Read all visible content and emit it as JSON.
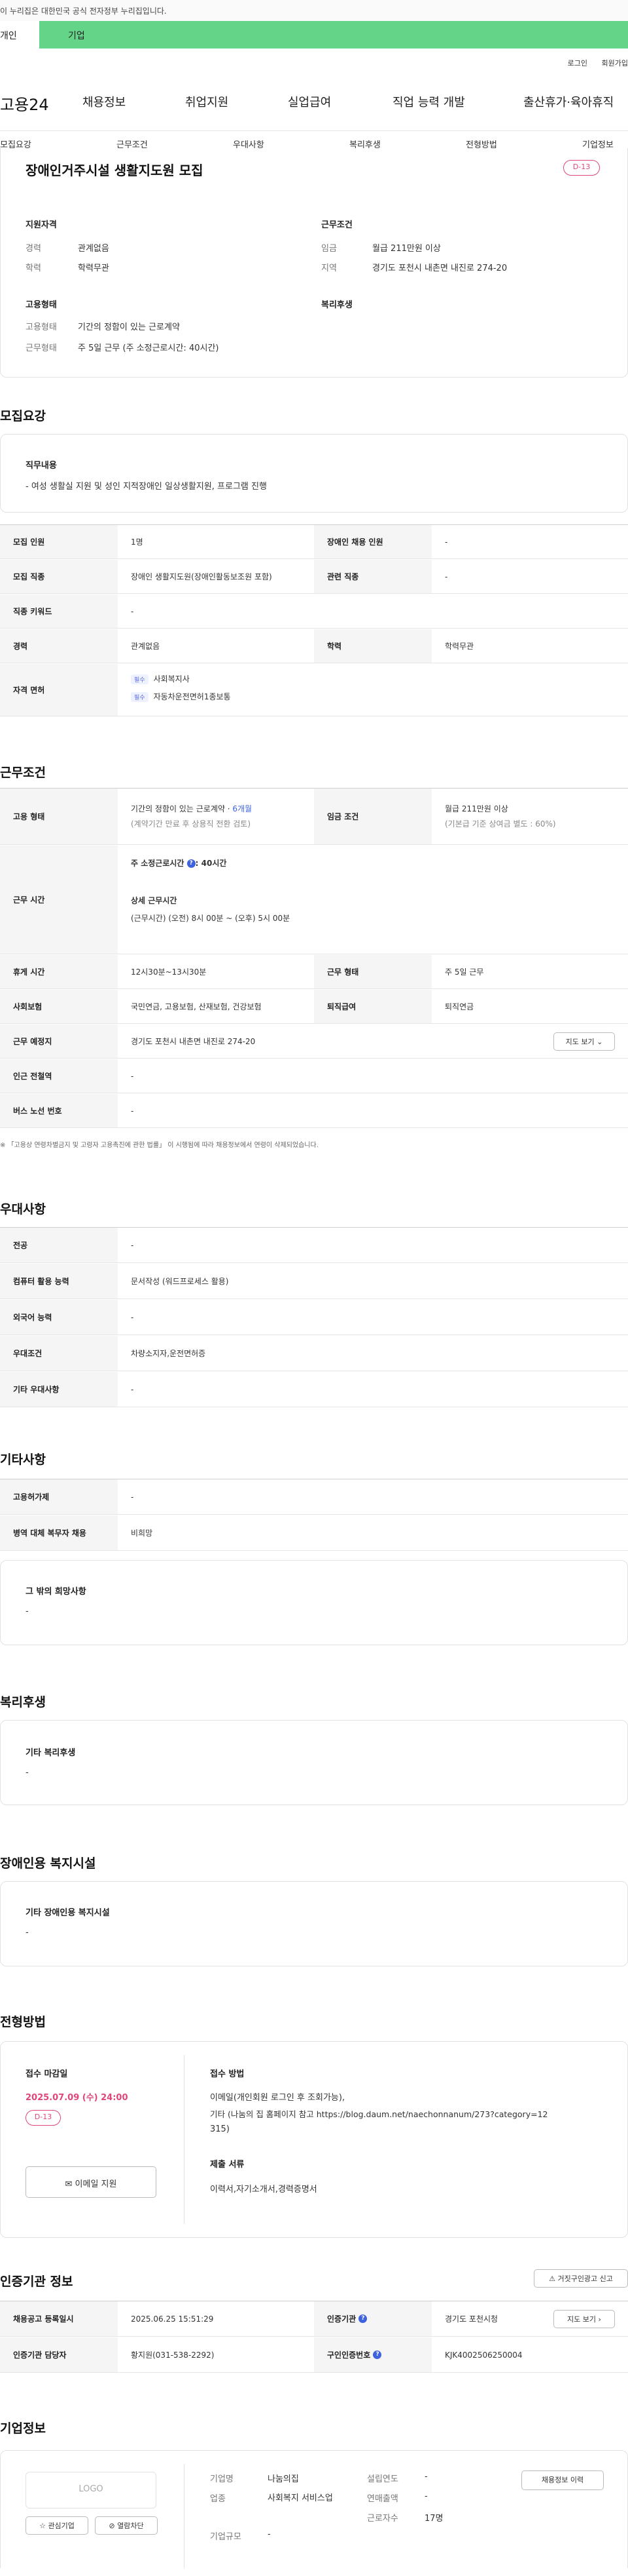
{
  "gov_banner": "이 누리집은 대한민국 공식 전자정부 누리집입니다.",
  "user_tabs": {
    "personal": "개인",
    "company": "기업"
  },
  "top_links": {
    "login": "로그인",
    "join": "회원가입"
  },
  "brand": "고용24",
  "gnb": [
    "채용정보",
    "취업지원",
    "실업급여",
    "직업 능력 개발",
    "출산휴가·육아휴직"
  ],
  "subnav": [
    "모집요강",
    "근무조건",
    "우대사항",
    "복리후생",
    "전형방법",
    "기업정보"
  ],
  "header": {
    "title": "장애인거주시설 생활지도원 모집",
    "dday": "D-13",
    "qual_title": "지원자격",
    "qual": [
      {
        "l": "경력",
        "v": "관계없음"
      },
      {
        "l": "학력",
        "v": "학력무관"
      }
    ],
    "work_title": "근무조건",
    "work": [
      {
        "l": "임금",
        "v": "월급 211만원 이상"
      },
      {
        "l": "지역",
        "v": "경기도 포천시 내촌면 내진로 274-20"
      }
    ],
    "emp_title": "고용형태",
    "emp": [
      {
        "l": "고용형태",
        "v": "기간의 정함이 있는 근로계약"
      },
      {
        "l": "근무형태",
        "v": "주 5일 근무 (주 소정근로시간: 40시간)"
      }
    ],
    "welfare_title": "복리후생"
  },
  "recruit": {
    "section": "모집요강",
    "duty_title": "직무내용",
    "duty": "- 여성 생활실 지원 및 성인 지적장애인 일상생활지원, 프로그램 진행",
    "rows": [
      {
        "th": "모집 인원",
        "td": "1명",
        "th2": "장애인 채용 인원",
        "td2": "-"
      },
      {
        "th": "모집 직종",
        "td": "장애인 생활지도원(장애인활동보조원 포함)",
        "th2": "관련 직종",
        "td2": "-"
      },
      {
        "th": "직종 키워드",
        "td": "-"
      },
      {
        "th": "경력",
        "td": "관계없음",
        "th2": "학력",
        "td2": "학력무관"
      }
    ],
    "cert_th": "자격 면허",
    "certs": [
      {
        "badge": "필수",
        "name": "사회복지사"
      },
      {
        "badge": "필수",
        "name": "자동차운전면허1종보통"
      }
    ]
  },
  "cond": {
    "section": "근무조건",
    "type_th": "고용 형태",
    "type_td1_a": "기간의 정함이 있는 근로계약 · ",
    "type_td1_b": "6개월",
    "type_td2": "(계약기간 만료 후 상용직 전환 검토)",
    "wage_th": "임금 조건",
    "wage_td1": "월급 211만원 이상",
    "wage_td2": "(기본급 기준 상여금 별도 : 60%)",
    "time_th": "근무 시간",
    "time_a": "주 소정근로시간",
    "time_a2": ": 40시간",
    "time_b": "상세 근무시간",
    "time_c": "(근무시간) (오전) 8시 00분 ~ (오후) 5시 00분",
    "rows": [
      {
        "th": "휴게 시간",
        "td": "12시30분~13시30분",
        "th2": "근무 형태",
        "td2": "주 5일 근무"
      },
      {
        "th": "사회보험",
        "td": "국민연금, 고용보험, 산재보험, 건강보험",
        "th2": "퇴직급여",
        "td2": "퇴직연금"
      },
      {
        "th": "근무 예정지",
        "td": "경기도 포천시 내촌면 내진로 274-20"
      },
      {
        "th": "인근 전철역",
        "td": "-"
      },
      {
        "th": "버스 노선 번호",
        "td": "-"
      }
    ],
    "map_btn": "지도 보기",
    "notice": "「고용상 연령차별금지 및 고령자 고용촉진에 관한 법률」 이 시행됨에 따라 채용정보에서 연령이 삭제되었습니다."
  },
  "pref": {
    "section": "우대사항",
    "rows": [
      {
        "th": "전공",
        "td": "-"
      },
      {
        "th": "컴퓨터 활용 능력",
        "td": "문서작성 (워드프로세스 활용)"
      },
      {
        "th": "외국어 능력",
        "td": "-"
      },
      {
        "th": "우대조건",
        "td": "차량소지자,운전면허증"
      },
      {
        "th": "기타 우대사항",
        "td": "-"
      }
    ]
  },
  "etc": {
    "section": "기타사항",
    "rows": [
      {
        "th": "고용허가제",
        "td": "-"
      },
      {
        "th": "병역 대체 복무자 채용",
        "td": "비희망"
      }
    ],
    "hope_title": "그 밖의 희망사항",
    "hope": "-"
  },
  "welfare": {
    "section": "복리후생",
    "title": "기타 복리후생",
    "v": "-"
  },
  "facility": {
    "section": "장애인용 복지시설",
    "title": "기타 장애인용 복지시설",
    "v": "-"
  },
  "process": {
    "section": "전형방법",
    "deadline_title": "접수 마감일",
    "deadline": "2025.07.09 (수) 24:00",
    "dday": "D-13",
    "email_btn": "이메일 지원",
    "method_title": "접수 방법",
    "method1": "이메일(개인회원 로그인 후 조회가능),",
    "method2": "기타 (나눔의 집 홈페이지 참고 https://blog.daum.net/naechonnanum/273?category=12",
    "method3": "315)",
    "docs_title": "제출 서류",
    "docs": "이력서,자기소개서,경력증명서"
  },
  "agency": {
    "section": "인증기관 정보",
    "report_btn": "거짓구인광고 신고",
    "r1": {
      "th": "채용공고 등록일시",
      "td": "2025.06.25 15:51:29",
      "th2": "인증기관",
      "td2": "경기도 포천시청"
    },
    "r2": {
      "th": "인증기관 담당자",
      "td": "황지원(031-538-2292)",
      "th2": "구인인증번호",
      "td2": "KJK40025062500​04"
    },
    "map_btn": "지도 보기"
  },
  "company": {
    "section": "기업정보",
    "logo": "LOGO",
    "fav_btn": "관심기업",
    "block_btn": "열람차단",
    "history_btn": "채용정보 이력",
    "info": [
      {
        "l": "기업명",
        "v": "나눔의집"
      },
      {
        "l": "업종",
        "v": "사회복지 서비스업"
      },
      {
        "l": "기업규모",
        "v": "-"
      }
    ],
    "info2": [
      {
        "l": "설립연도",
        "v": "-"
      },
      {
        "l": "연매출액",
        "v": "-"
      },
      {
        "l": "근로자수",
        "v": "17명"
      }
    ]
  },
  "colors": {
    "green": "#64d489",
    "accent": "#e0457b",
    "blue": "#3e63dd"
  }
}
